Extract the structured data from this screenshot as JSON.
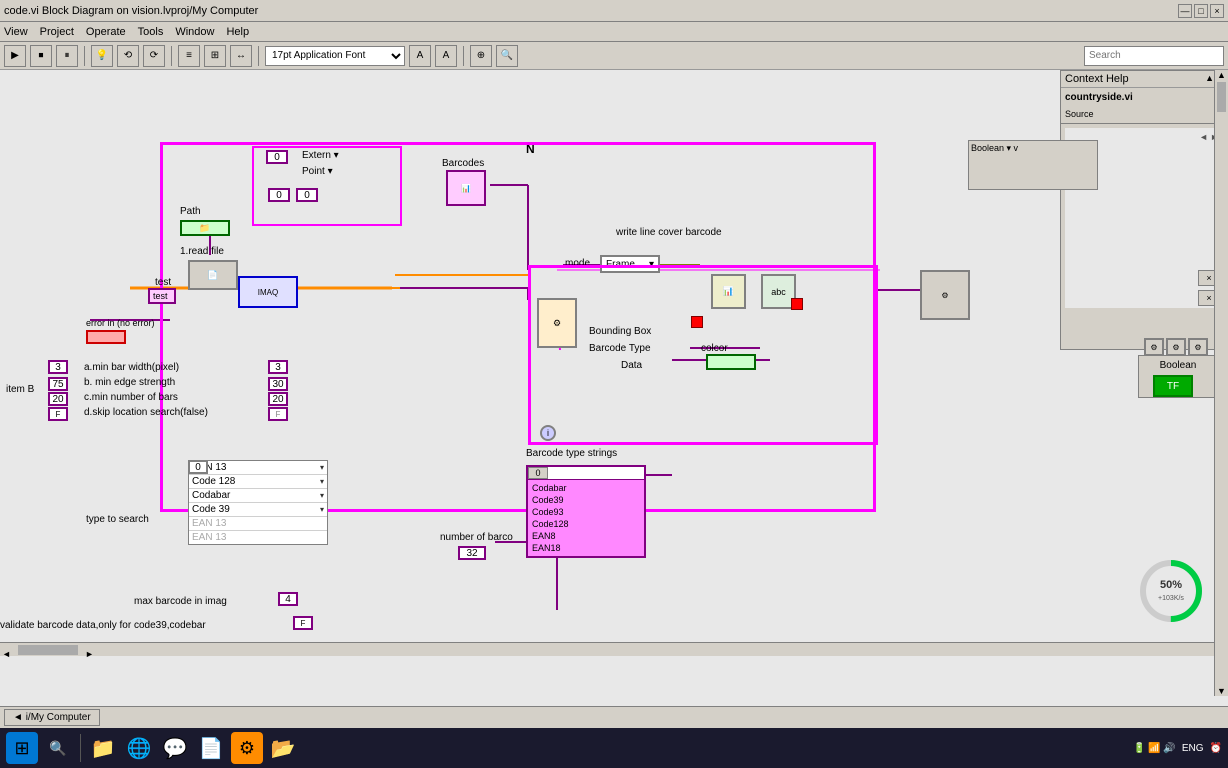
{
  "titlebar": {
    "title": "code.vi Block Diagram on vision.lvproj/My Computer",
    "controls": [
      "—",
      "□",
      "×"
    ]
  },
  "menubar": {
    "items": [
      "View",
      "Project",
      "Operate",
      "Tools",
      "Window",
      "Help"
    ]
  },
  "toolbar": {
    "font_selector": "17pt Application Font",
    "search_placeholder": "Search",
    "buttons": [
      "▶",
      "⏹",
      "⏸",
      "⚡",
      "⟳",
      "⟲",
      "≡",
      "⊞",
      "⊟",
      "↔",
      "⊕"
    ]
  },
  "canvas": {
    "barcodes_label": "Barcodes",
    "path_label": "Path",
    "read_file_label": "1.read file",
    "test_label": "test",
    "error_label": "error in (no error)",
    "write_line_label": "write line cover barcode",
    "mode_label": "mode",
    "frame_label": "Frame",
    "bounding_box_label": "Bounding Box",
    "barcode_type_label": "Barcode Type",
    "data_label": "Data",
    "color_label": "colcor",
    "barcode_strings_label": "Barcode type strings",
    "number_of_barcode_label": "number of barco",
    "type_to_search_label": "type to search",
    "max_barcode_label": "max barcode in imag",
    "validate_label": "validate barcode data,only for code39,codebar",
    "param_a": "a.min bar width(pixel)",
    "param_b": "b. min edge strength",
    "param_c": "c.min number of bars",
    "param_d": "d.skip location search(false)",
    "val_a": "3",
    "val_b": "75",
    "val_c": "20",
    "val_d": "F",
    "val_a2": "3",
    "val_b2": "30",
    "val_c2": "20",
    "item_b_label": "item B",
    "dropdown_items": [
      {
        "label": "EAN 13",
        "has_arrow": true
      },
      {
        "label": "Code 128",
        "has_arrow": true
      },
      {
        "label": "Codabar",
        "has_arrow": true
      },
      {
        "label": "Code 39",
        "has_arrow": true
      },
      {
        "label": "EAN 13",
        "has_arrow": false,
        "grayed": true
      },
      {
        "label": "EAN 13",
        "has_arrow": false,
        "grayed": true
      }
    ],
    "index_val": "0",
    "index_val2": "0",
    "barcode_list": [
      "Codabar",
      "Code39",
      "Code93",
      "Code128",
      "EAN8",
      "EAN18"
    ],
    "num_val_4": "4",
    "num_val_32": "32",
    "bounding_label_text": "Bounding",
    "source_label": "Source",
    "context_help_label": "Context Help",
    "countryside_label": "countryside.vi",
    "boolean_label": "Boolean",
    "boolean_val": "TF",
    "progress_pct": "50%",
    "progress_sub": "+103K/s",
    "n_label": "N"
  },
  "bottom_tab": {
    "label": "i/My Computer",
    "arrow": "◄"
  },
  "taskbar": {
    "icons": [
      {
        "name": "start-icon",
        "symbol": "⊞",
        "color": "#0078d4"
      },
      {
        "name": "search-taskbar-icon",
        "symbol": "🔍",
        "color": "#555"
      },
      {
        "name": "file-manager-icon",
        "symbol": "📁",
        "color": "#f0c040"
      },
      {
        "name": "browser-icon",
        "symbol": "🌐",
        "color": "#4a90d9"
      },
      {
        "name": "chat-icon",
        "symbol": "💬",
        "color": "#00c853"
      },
      {
        "name": "pdf-icon",
        "symbol": "📄",
        "color": "#d32f2f"
      },
      {
        "name": "labview-icon",
        "symbol": "⚙",
        "color": "#ff8c00"
      },
      {
        "name": "folder-icon",
        "symbol": "📂",
        "color": "#1565c0"
      }
    ],
    "system_tray": {
      "battery": "🔋",
      "wifi": "📶",
      "volume": "🔊",
      "ime": "ENG",
      "time": "...",
      "show_desktop": ""
    }
  }
}
